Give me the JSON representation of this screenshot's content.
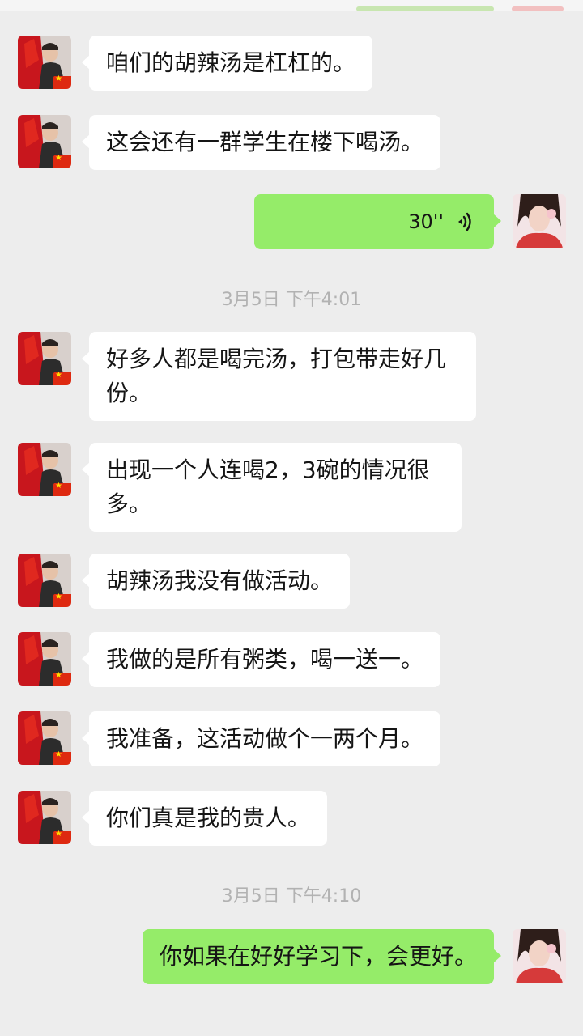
{
  "messages": [
    {
      "text": "咱们的胡辣汤是杠杠的。"
    },
    {
      "text": "这会还有一群学生在楼下喝汤。"
    },
    {
      "voice": {
        "duration": "30''",
        "icon": "voice-wave-icon"
      }
    },
    {
      "time": "3月5日 下午4:01"
    },
    {
      "text": "好多人都是喝完汤，打包带走好几份。"
    },
    {
      "text": "出现一个人连喝2，3碗的情况很多。"
    },
    {
      "text": "胡辣汤我没有做活动。"
    },
    {
      "text": "我做的是所有粥类，喝一送一。"
    },
    {
      "text": "我准备，这活动做个一两个月。"
    },
    {
      "text": "你们真是我的贵人。"
    },
    {
      "time": "3月5日 下午4:10"
    },
    {
      "text": "你如果在好好学习下，会更好。"
    }
  ],
  "colors": {
    "background": "#ededed",
    "incoming_bubble": "#ffffff",
    "outgoing_bubble": "#95ec69",
    "timestamp": "#b2b2b2"
  }
}
